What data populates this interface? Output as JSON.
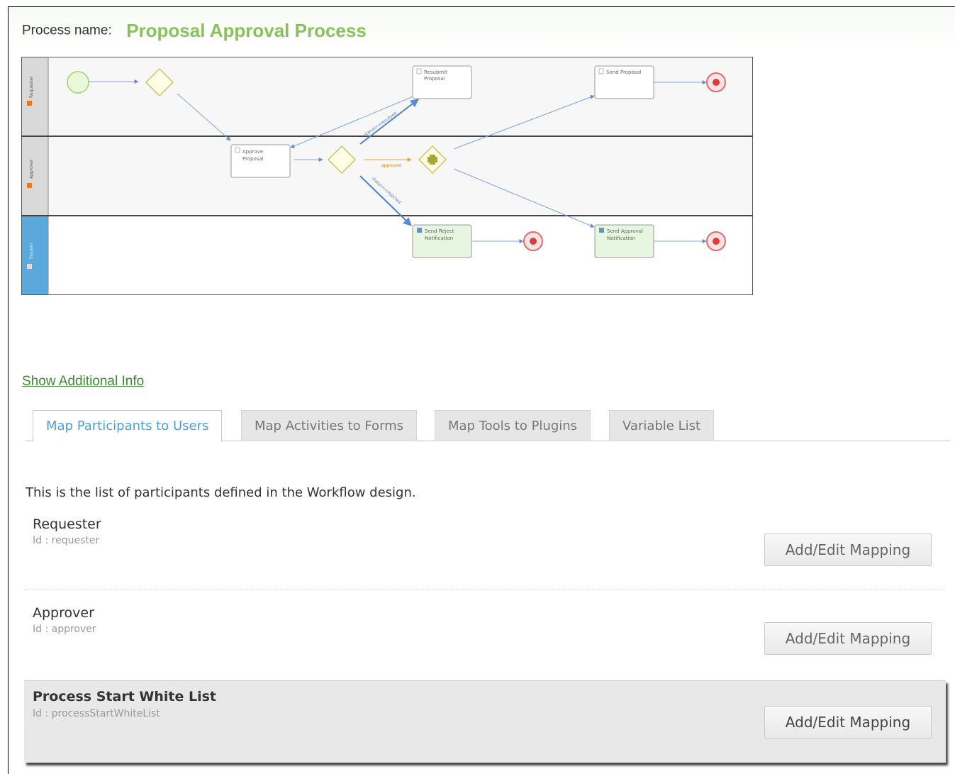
{
  "process": {
    "label": "Process name:",
    "name": "Proposal Approval Process"
  },
  "diagram": {
    "lanes": [
      "Requester",
      "Approver",
      "System"
    ],
    "nodes": {
      "resubmit": [
        "Resubmit",
        "Proposal"
      ],
      "send_proposal": [
        "Send Proposal"
      ],
      "approve": [
        "Approve",
        "Proposal"
      ],
      "reject_notify": [
        "Send Reject",
        "Notification"
      ],
      "approval_notify": [
        "Send Approval",
        "Notification"
      ]
    },
    "edges": {
      "approved": "approved",
      "resubmit": "status==resubmit",
      "rejected": "status==rejected"
    }
  },
  "show_info": "Show Additional Info",
  "tabs": [
    {
      "label": "Map Participants to Users",
      "active": true
    },
    {
      "label": "Map Activities to Forms",
      "active": false
    },
    {
      "label": "Map Tools to Plugins",
      "active": false
    },
    {
      "label": "Variable List",
      "active": false
    }
  ],
  "description": "This is the list of participants defined in the Workflow design.",
  "participants": [
    {
      "name": "Requester",
      "id": "Id : requester",
      "button": "Add/Edit Mapping"
    },
    {
      "name": "Approver",
      "id": "Id : approver",
      "button": "Add/Edit Mapping"
    },
    {
      "name": "Process Start White List",
      "id": "Id : processStartWhiteList",
      "button": "Add/Edit Mapping"
    }
  ],
  "colors": {
    "title": "#88c25a",
    "link": "#3a8d2c",
    "active_tab": "#4a9fd8"
  }
}
